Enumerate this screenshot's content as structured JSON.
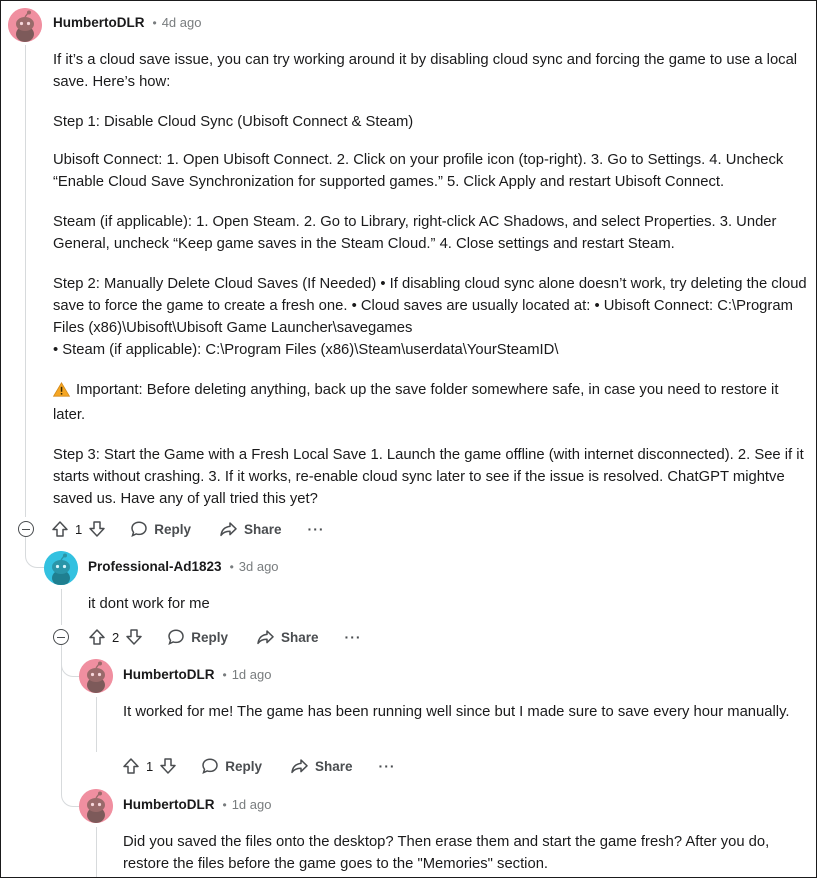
{
  "comments": [
    {
      "user": "HumbertoDLR",
      "time": "4d ago",
      "paragraphs": [
        "If it’s a cloud save issue, you can try working around it by disabling cloud sync and forcing the game to use a local save. Here’s how:",
        "Step 1: Disable Cloud Sync (Ubisoft Connect & Steam)",
        "Ubisoft Connect: 1. Open Ubisoft Connect. 2. Click on your profile icon (top-right). 3. Go to Settings. 4. Uncheck “Enable Cloud Save Synchronization for supported games.” 5. Click Apply and restart Ubisoft Connect.",
        "Steam (if applicable): 1. Open Steam. 2. Go to Library, right-click AC Shadows, and select Properties. 3. Under General, uncheck “Keep game saves in the Steam Cloud.” 4. Close settings and restart Steam.",
        "Step 2: Manually Delete Cloud Saves (If Needed) • If disabling cloud sync alone doesn’t work, try deleting the cloud save to force the game to create a fresh one. • Cloud saves are usually located at: • Ubisoft Connect: C:\\Program Files (x86)\\Ubisoft\\Ubisoft Game Launcher\\savegames",
        "• Steam (if applicable): C:\\Program Files (x86)\\Steam\\userdata\\YourSteamID\\",
        "Important: Before deleting anything, back up the save folder somewhere safe, in case you need to restore it later.",
        "Step 3: Start the Game with a Fresh Local Save 1. Launch the game offline (with internet disconnected). 2. See if it starts without crashing. 3. If it works, re-enable cloud sync later to see if the issue is resolved. ChatGPT mightve saved us. Have any of yall tried this yet?"
      ],
      "votes": "1"
    },
    {
      "user": "Professional-Ad1823",
      "time": "3d ago",
      "text": "it dont work for me",
      "votes": "2"
    },
    {
      "user": "HumbertoDLR",
      "time": "1d ago",
      "text": "It worked for me! The game has been running well since but I made sure to save every hour manually.",
      "votes": "1"
    },
    {
      "user": "HumbertoDLR",
      "time": "1d ago",
      "text": "Did you saved the files onto the desktop? Then erase them and start the game fresh? After you do, restore the files before the game goes to the \"Memories\" section."
    }
  ],
  "actions": {
    "reply": "Reply",
    "share": "Share",
    "more": "···",
    "dot": "•"
  },
  "icons": {
    "warning": "warning-icon",
    "upvote": "upvote-icon",
    "downvote": "downvote-icon",
    "reply": "reply-bubble-icon",
    "share": "share-arrow-icon",
    "collapse": "collapse-icon"
  },
  "colors": {
    "avatar_pink": "#f08fa0",
    "avatar_cyan": "#33c1e0",
    "snoo_body": "#9a6a6a",
    "text": "#1a1a1b",
    "meta": "#787c7e",
    "warn": "#f5a623"
  }
}
